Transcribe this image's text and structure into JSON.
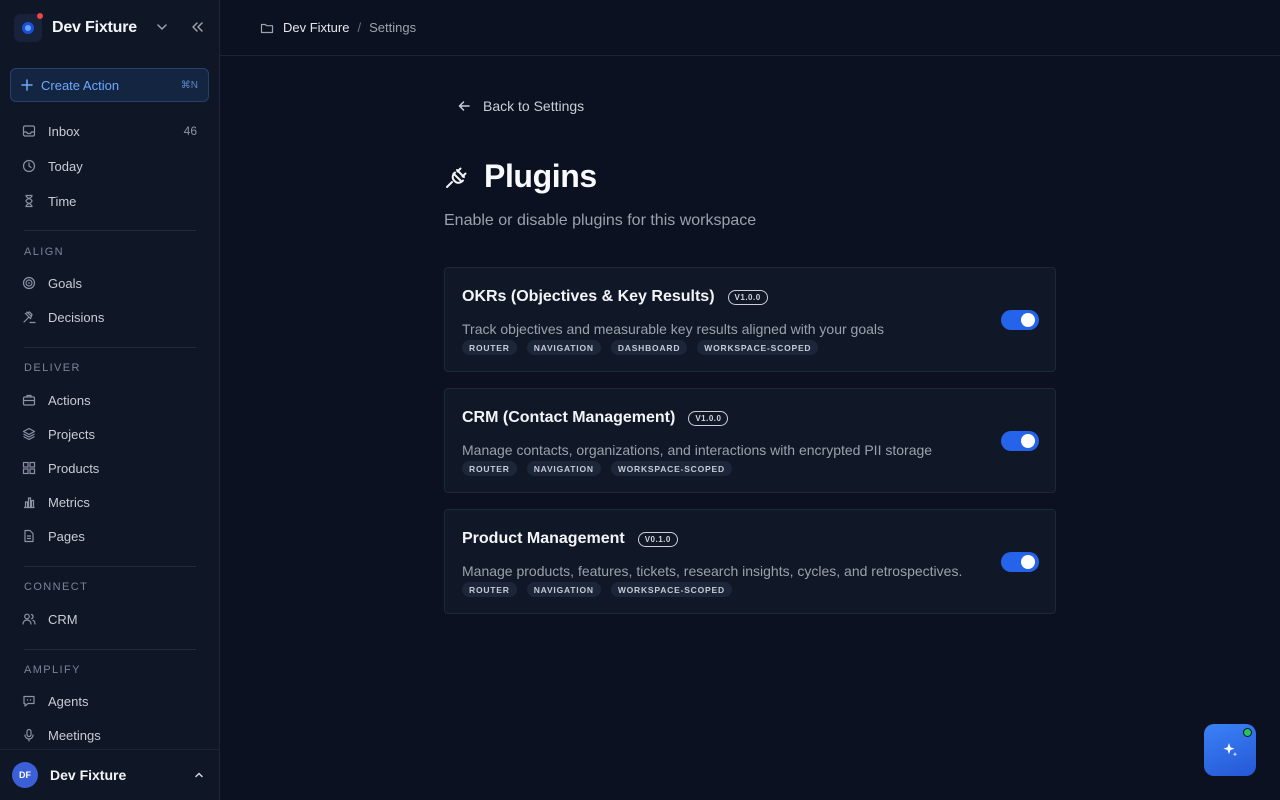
{
  "workspace": {
    "name": "Dev Fixture"
  },
  "sidebar": {
    "create_action": {
      "label": "Create Action",
      "shortcut": "⌘N"
    },
    "top_items": [
      {
        "label": "Inbox",
        "count": "46",
        "icon": "inbox-icon"
      },
      {
        "label": "Today",
        "icon": "clock-icon"
      },
      {
        "label": "Time",
        "icon": "hourglass-icon"
      }
    ],
    "sections": [
      {
        "label": "ALIGN",
        "items": [
          {
            "label": "Goals",
            "icon": "target-icon"
          },
          {
            "label": "Decisions",
            "icon": "gavel-icon"
          }
        ]
      },
      {
        "label": "DELIVER",
        "items": [
          {
            "label": "Actions",
            "icon": "briefcase-icon"
          },
          {
            "label": "Projects",
            "icon": "layers-icon"
          },
          {
            "label": "Products",
            "icon": "grid-icon"
          },
          {
            "label": "Metrics",
            "icon": "bar-chart-icon"
          },
          {
            "label": "Pages",
            "icon": "file-icon"
          }
        ]
      },
      {
        "label": "CONNECT",
        "items": [
          {
            "label": "CRM",
            "icon": "users-icon"
          }
        ]
      },
      {
        "label": "AMPLIFY",
        "items": [
          {
            "label": "Agents",
            "icon": "chat-bot-icon"
          },
          {
            "label": "Meetings",
            "icon": "microphone-icon"
          }
        ]
      }
    ],
    "user": {
      "initials": "DF",
      "name": "Dev Fixture"
    }
  },
  "breadcrumb": {
    "root": "Dev Fixture",
    "separator": "/",
    "current": "Settings"
  },
  "main": {
    "back_label": "Back to Settings",
    "title": "Plugins",
    "subtitle": "Enable or disable plugins for this workspace",
    "plugins": [
      {
        "name": "OKRs (Objectives & Key Results)",
        "version": "V1.0.0",
        "description": "Track objectives and measurable key results aligned with your goals",
        "tags": [
          "ROUTER",
          "NAVIGATION",
          "DASHBOARD",
          "WORKSPACE-SCOPED"
        ],
        "enabled": true
      },
      {
        "name": "CRM (Contact Management)",
        "version": "V1.0.0",
        "description": "Manage contacts, organizations, and interactions with encrypted PII storage",
        "tags": [
          "ROUTER",
          "NAVIGATION",
          "WORKSPACE-SCOPED"
        ],
        "enabled": true
      },
      {
        "name": "Product Management",
        "version": "V0.1.0",
        "description": "Manage products, features, tickets, research insights, cycles, and retrospectives.",
        "tags": [
          "ROUTER",
          "NAVIGATION",
          "WORKSPACE-SCOPED"
        ],
        "enabled": true
      }
    ]
  },
  "colors": {
    "accent": "#2563eb",
    "background": "#0b1120",
    "sidebar": "#0f1626"
  }
}
